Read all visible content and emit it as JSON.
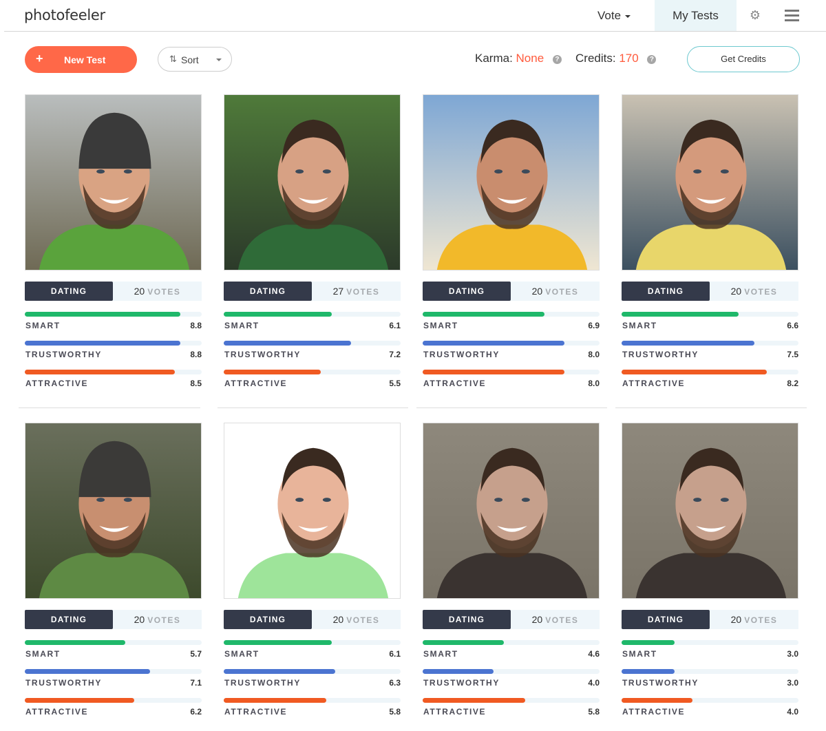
{
  "header": {
    "logo": "photofeeler",
    "nav": {
      "vote": "Vote",
      "my_tests": "My Tests"
    },
    "icons": {
      "settings": "gear-icon",
      "menu": "hamburger-menu-icon"
    }
  },
  "toolbar": {
    "new_test_label": "New Test",
    "new_test_icon": "+",
    "sort_label": "Sort",
    "karma_label": "Karma:",
    "karma_value": "None",
    "credits_label": "Credits:",
    "credits_value": "170",
    "help_glyph": "?",
    "get_credits_label": "Get Credits"
  },
  "colors": {
    "accent": "#ff6848",
    "smart": "#1fb86a",
    "trustworthy": "#4b74d1",
    "attractive": "#f05a22",
    "tag_dark": "#343a4a"
  },
  "metric_labels": {
    "smart": "SMART",
    "trustworthy": "TRUSTWORTHY",
    "attractive": "ATTRACTIVE"
  },
  "votes_word": "VOTES",
  "scale_max": 10,
  "tests": [
    {
      "category": "DATING",
      "votes": "20",
      "smart": "8.8",
      "trustworthy": "8.8",
      "attractive": "8.5",
      "photo": "mountain-beanie-selfie"
    },
    {
      "category": "DATING",
      "votes": "27",
      "smart": "6.1",
      "trustworthy": "7.2",
      "attractive": "5.5",
      "photo": "phone-booth-selfie"
    },
    {
      "category": "DATING",
      "votes": "20",
      "smart": "6.9",
      "trustworthy": "8.0",
      "attractive": "8.0",
      "photo": "beach-selfie"
    },
    {
      "category": "DATING",
      "votes": "20",
      "smart": "6.6",
      "trustworthy": "7.5",
      "attractive": "8.2",
      "photo": "harbor-selfie"
    },
    {
      "category": "DATING",
      "votes": "20",
      "smart": "5.7",
      "trustworthy": "7.1",
      "attractive": "6.2",
      "photo": "fjord-selfie"
    },
    {
      "category": "DATING",
      "votes": "20",
      "smart": "6.1",
      "trustworthy": "6.3",
      "attractive": "5.8",
      "photo": "white-background-smile"
    },
    {
      "category": "DATING",
      "votes": "20",
      "smart": "4.6",
      "trustworthy": "4.0",
      "attractive": "5.8",
      "photo": "plaid-shirt-smirk"
    },
    {
      "category": "DATING",
      "votes": "20",
      "smart": "3.0",
      "trustworthy": "3.0",
      "attractive": "4.0",
      "photo": "plaid-shirt-side-glance"
    }
  ]
}
